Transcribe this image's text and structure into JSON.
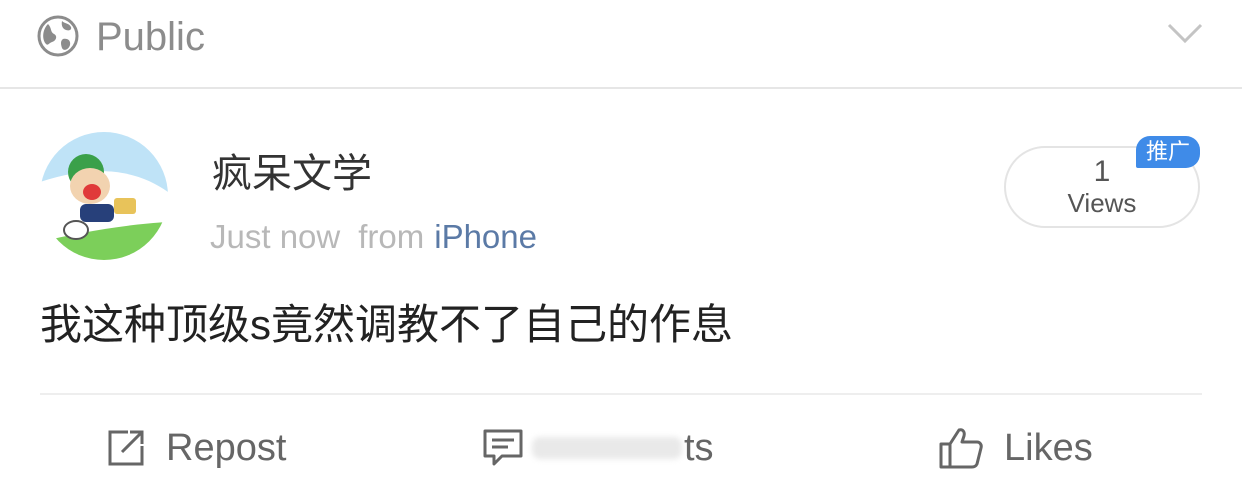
{
  "header": {
    "visibility_label": "Public",
    "icons": {
      "visibility": "globe-icon",
      "expand": "chevron-down-icon"
    }
  },
  "post": {
    "author_name": "疯呆文学",
    "time": "Just now",
    "from_label": "from",
    "device": "iPhone",
    "text": "我这种顶级s竟然调教不了自己的作息",
    "views": {
      "count": "1",
      "label": "Views",
      "badge": "推广"
    }
  },
  "actions": {
    "repost_label": "Repost",
    "comments_label_visible": "ts",
    "likes_label": "Likes"
  },
  "colors": {
    "link_blue": "#5b7aa6",
    "badge_blue": "#3f8be8",
    "muted_text": "#b8b8b8"
  }
}
